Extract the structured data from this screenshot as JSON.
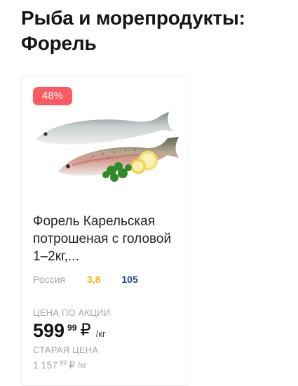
{
  "page": {
    "title": "Рыба и морепродукты: Форель"
  },
  "product": {
    "discount_badge": "48%",
    "image_icon": "trout-fish-image",
    "name": "Форель Карельская потрошеная с головой 1–2кг,...",
    "country": "Россия",
    "rating": "3,8",
    "reviews": "105",
    "promo_label": "ЦЕНА ПО АКЦИИ",
    "price": {
      "integer": "599",
      "cents": "99",
      "currency": "₽",
      "unit": "/кг"
    },
    "old_label": "СТАРАЯ ЦЕНА",
    "old_price": {
      "integer": "1 157",
      "cents": "89",
      "currency": "₽",
      "unit": "/кг"
    }
  },
  "colors": {
    "badge": "#ff5a5f",
    "rating": "#f2b705",
    "reviews": "#22438c",
    "muted": "#a5a5a5"
  }
}
